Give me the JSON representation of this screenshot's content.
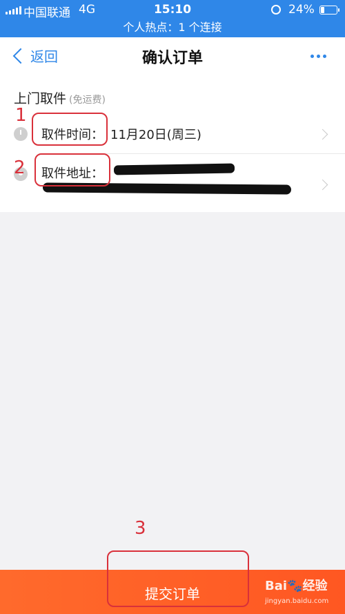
{
  "status_bar": {
    "carrier": "中国联通",
    "network": "4G",
    "time": "15:10",
    "battery": "24%",
    "battery_level": 0.24
  },
  "hotspot_text": "个人热点：1 个连接",
  "nav": {
    "back_label": "返回",
    "title": "确认订单"
  },
  "section": {
    "title": "上门取件",
    "subtitle": "(免运费)"
  },
  "rows": [
    {
      "label": "取件时间：",
      "value": "11月20日(周三)"
    },
    {
      "label": "取件地址："
    }
  ],
  "annotations": [
    "1",
    "2",
    "3"
  ],
  "submit_label": "提交订单",
  "watermark": {
    "brand": "Bai🐾经验",
    "url": "jingyan.baidu.com"
  },
  "colors": {
    "accent": "#2f87e8",
    "submit": "#ff5722",
    "annotation": "#d9303a"
  }
}
